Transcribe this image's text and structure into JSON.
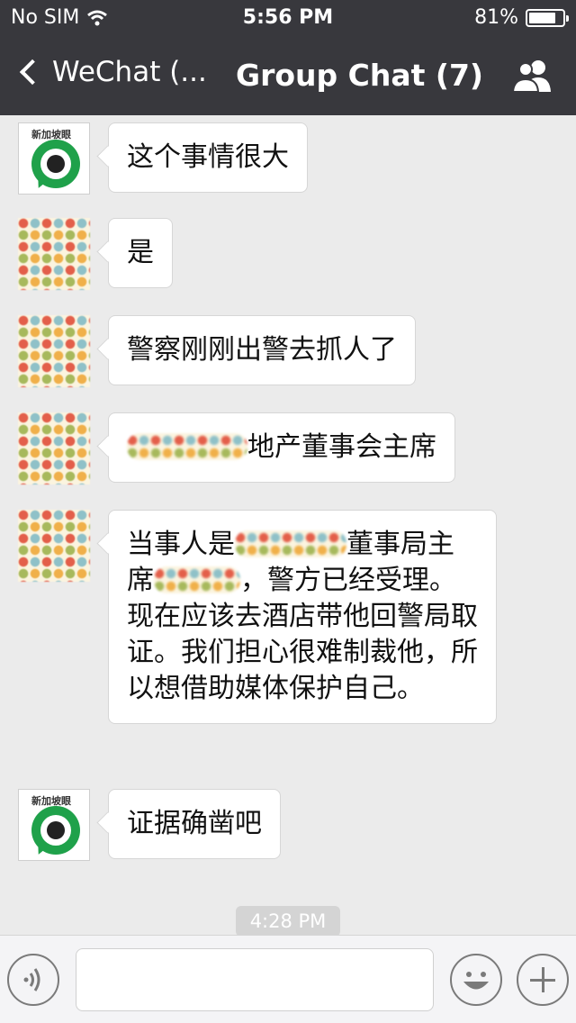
{
  "status_bar": {
    "carrier": "No SIM",
    "time": "5:56 PM",
    "battery": "81%",
    "battery_level": 0.81
  },
  "nav": {
    "back_label": "WeChat (...",
    "title": "Group Chat (7)",
    "group_icon": "group-members-icon"
  },
  "messages": [
    {
      "avatar": "news-account-logo",
      "avatar_text": "新加坡眼",
      "parts": [
        "这个事情很大"
      ]
    },
    {
      "avatar": "polka-dot-avatar",
      "parts": [
        "是"
      ]
    },
    {
      "avatar": "polka-dot-avatar",
      "parts": [
        "警察刚刚出警去抓人了"
      ]
    },
    {
      "avatar": "polka-dot-avatar",
      "parts": [
        "地产董事会主席"
      ]
    },
    {
      "avatar": "polka-dot-avatar",
      "parts": [
        "当事人是",
        "董事局主席",
        "，警方已经受理。现在应该去酒店带他回警局取证。我们担心很难制裁他，所以想借助媒体保护自己。"
      ]
    },
    {
      "avatar": "news-account-logo",
      "avatar_text": "新加坡眼",
      "parts": [
        "证据确凿吧"
      ]
    }
  ],
  "timestamp": "4:28 PM",
  "input_bar": {
    "voice_icon": "voice-icon",
    "emoji_icon": "emoji-icon",
    "plus_icon": "plus-icon",
    "text_value": ""
  },
  "colors": {
    "nav_bg": "#38383d",
    "chat_bg": "#ebebeb",
    "bubble_bg": "#ffffff",
    "logo_green": "#1fa14a"
  }
}
